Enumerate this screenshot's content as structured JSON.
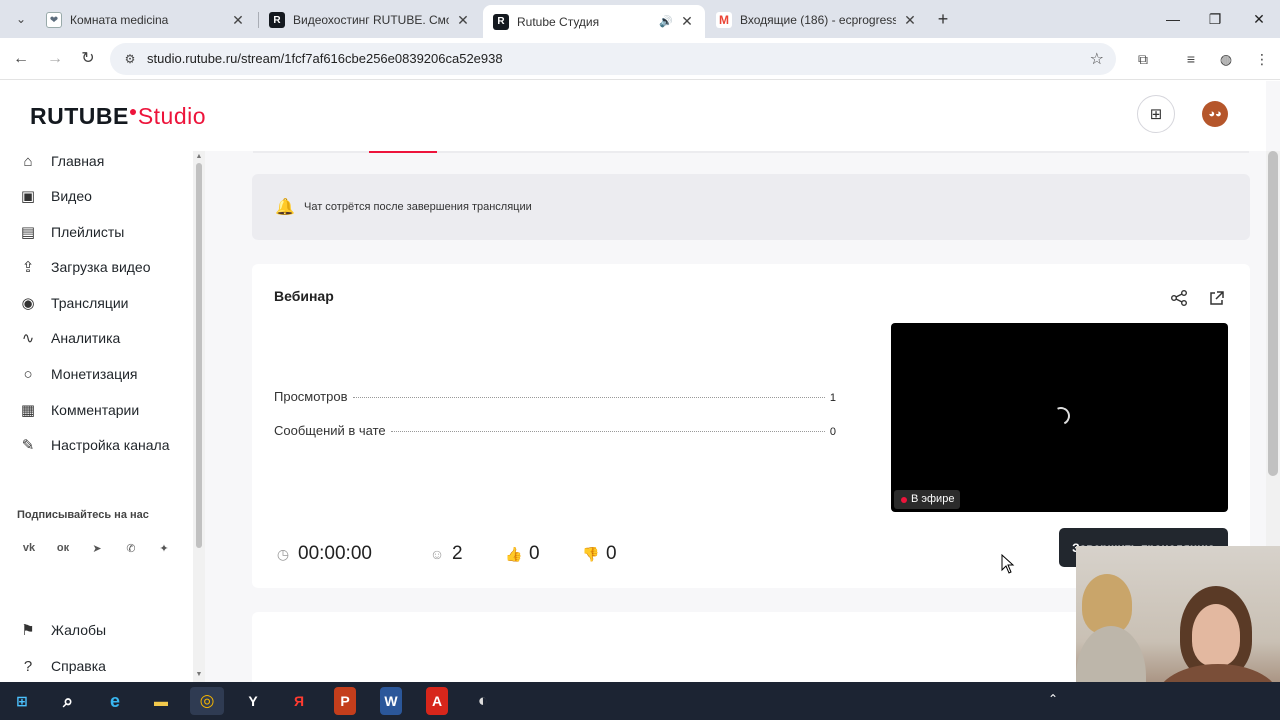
{
  "browser": {
    "tabs": [
      {
        "title": "Комната medicina",
        "favicon_color": "#5b6b7c",
        "favicon": "icon-heart",
        "active": false
      },
      {
        "title": "Видеохостинг RUTUBE. Смотр...",
        "favicon_color": "#14191f",
        "favicon": "R",
        "active": false
      },
      {
        "title": "Rutube Студия",
        "favicon_color": "#14191f",
        "favicon": "R",
        "active": true
      },
      {
        "title": "Входящие (186) - ecprogress@",
        "favicon_color": "#ea4335",
        "favicon": "M",
        "active": false
      }
    ],
    "url": "studio.rutube.ru/stream/1fcf7af616cbe256e0839206ca52e938",
    "accent": "#ed143b"
  },
  "header": {
    "logo_main": "RUTUBE",
    "logo_studio": "Studio"
  },
  "sidebar": {
    "items": [
      {
        "label": "Главная",
        "icon": "home-icon",
        "glyph": "⌂"
      },
      {
        "label": "Видео",
        "icon": "video-icon",
        "glyph": "▣"
      },
      {
        "label": "Плейлисты",
        "icon": "playlist-icon",
        "glyph": "▤"
      },
      {
        "label": "Загрузка видео",
        "icon": "upload-icon",
        "glyph": "⇪"
      },
      {
        "label": "Трансляции",
        "icon": "broadcast-icon",
        "glyph": "◉"
      },
      {
        "label": "Аналитика",
        "icon": "chart-icon",
        "glyph": "∿"
      },
      {
        "label": "Монетизация",
        "icon": "coin-icon",
        "glyph": "○"
      },
      {
        "label": "Комментарии",
        "icon": "comments-icon",
        "glyph": "▦"
      },
      {
        "label": "Настройка канала",
        "icon": "magic-wand-icon",
        "glyph": "✎"
      }
    ],
    "follow_title": "Подписывайтесь на нас",
    "social": [
      {
        "name": "vk-icon",
        "glyph": "vk"
      },
      {
        "name": "ok-icon",
        "glyph": "ок"
      },
      {
        "name": "telegram-icon",
        "glyph": "➤"
      },
      {
        "name": "viber-icon",
        "glyph": "✆"
      },
      {
        "name": "more-icon",
        "glyph": "✦"
      }
    ],
    "bottom_items": [
      {
        "label": "Жалобы",
        "icon": "flag-icon",
        "glyph": "⚑"
      },
      {
        "label": "Справка",
        "icon": "help-icon",
        "glyph": "?"
      }
    ]
  },
  "notice": {
    "text": "Чат сотрётся после завершения трансляции"
  },
  "stream_card": {
    "title": "Вебинар",
    "stats": [
      {
        "label": "Просмотров",
        "value": "1"
      },
      {
        "label": "Сообщений в чате",
        "value": "0"
      }
    ],
    "live_label": "В эфире",
    "timer": "00:00:00",
    "viewers": "2",
    "likes": "0",
    "dislikes": "0",
    "end_button": "Завершить трансляцию"
  },
  "taskbar": {
    "apps": [
      {
        "name": "start-button",
        "glyph": "⊞"
      },
      {
        "name": "search-button",
        "glyph": "⌕"
      },
      {
        "name": "edge-app",
        "glyph": "e"
      },
      {
        "name": "explorer-app",
        "glyph": "▬"
      },
      {
        "name": "chrome-app",
        "glyph": "◎"
      },
      {
        "name": "yandex-browser-app",
        "glyph": "Y"
      },
      {
        "name": "yandex-app",
        "glyph": "Я"
      },
      {
        "name": "powerpoint-app",
        "glyph": "P"
      },
      {
        "name": "word-app",
        "glyph": "W"
      },
      {
        "name": "acrobat-app",
        "glyph": "A"
      },
      {
        "name": "obs-app",
        "glyph": "◐"
      }
    ]
  }
}
